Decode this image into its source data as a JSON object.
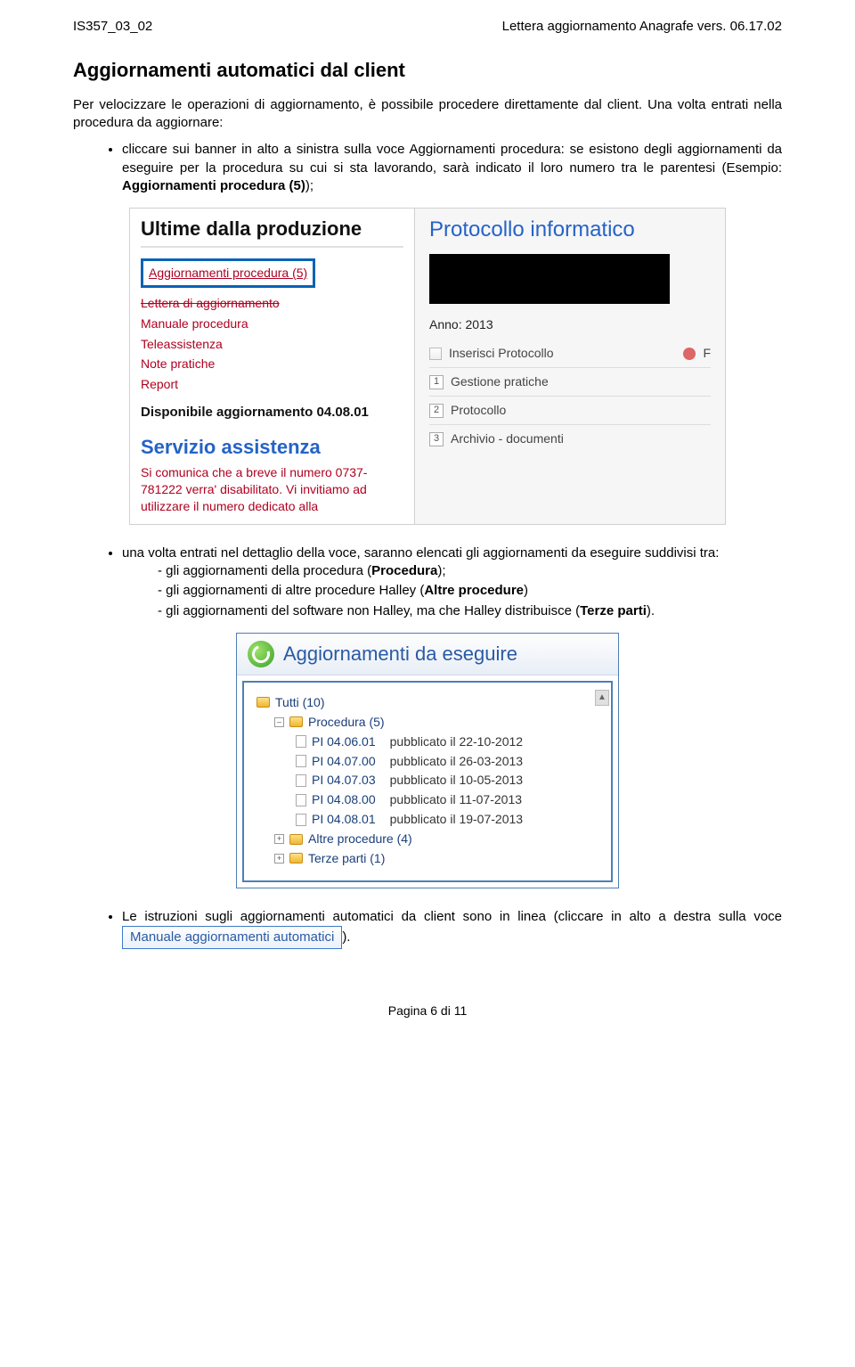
{
  "header": {
    "left": "IS357_03_02",
    "right": "Lettera aggiornamento Anagrafe vers. 06.17.02"
  },
  "title": "Aggiornamenti automatici dal client",
  "intro": "Per velocizzare le operazioni di aggiornamento, è possibile procedere direttamente dal client. Una volta entrati nella procedura da aggiornare:",
  "bullet1_a": "cliccare sui banner in alto a sinistra sulla voce ",
  "bullet1_b": "Aggiornamenti procedura",
  "bullet1_c": ": se esistono degli aggiornamenti da eseguire per la procedura su cui si sta lavorando, sarà indicato il loro numero tra le parentesi (Esempio: ",
  "bullet1_d": "Aggiornamenti procedura (5)",
  "bullet1_e": ");",
  "ss1": {
    "left_title": "Ultime dalla produzione",
    "link_highlight": "Aggiornamenti procedura (5)",
    "links": [
      "Lettera di aggiornamento",
      "Manuale procedura",
      "Teleassistenza",
      "Note pratiche",
      "Report"
    ],
    "dispo": "Disponibile aggiornamento 04.08.01",
    "serv_title": "Servizio assistenza",
    "serv_text": "Si comunica che a breve il numero 0737-781222 verra' disabilitato. Vi invitiamo ad utilizzare il numero dedicato alla",
    "right_title": "Protocollo informatico",
    "anno_label": "Anno:",
    "anno_value": "2013",
    "ins_proto": "Inserisci Protocollo",
    "ins_proto_end": "F",
    "menu": [
      {
        "n": "1",
        "label": "Gestione pratiche"
      },
      {
        "n": "2",
        "label": "Protocollo"
      },
      {
        "n": "3",
        "label": "Archivio - documenti"
      }
    ]
  },
  "bullet2": "una volta entrati nel dettaglio della voce, saranno elencati gli aggiornamenti da eseguire suddivisi tra:",
  "sub": {
    "a1": "gli aggiornamenti della procedura (",
    "a2": "Procedura",
    "a3": ");",
    "b1": "gli aggiornamenti di altre procedure Halley (",
    "b2": "Altre procedure",
    "b3": ")",
    "c1": "gli aggiornamenti del software non Halley, ma che Halley distribuisce (",
    "c2": "Terze parti",
    "c3": ")."
  },
  "ss2": {
    "title": "Aggiornamenti da eseguire",
    "root": "Tutti (10)",
    "proc": "Procedura (5)",
    "items": [
      {
        "v": "PI 04.06.01",
        "pub": "pubblicato il 22-10-2012"
      },
      {
        "v": "PI 04.07.00",
        "pub": "pubblicato il 26-03-2013"
      },
      {
        "v": "PI 04.07.03",
        "pub": "pubblicato il 10-05-2013"
      },
      {
        "v": "PI 04.08.00",
        "pub": "pubblicato il 11-07-2013"
      },
      {
        "v": "PI 04.08.01",
        "pub": "pubblicato il 19-07-2013"
      }
    ],
    "altre": "Altre procedure (4)",
    "terze": "Terze parti (1)"
  },
  "bullet3_a": "Le istruzioni sugli aggiornamenti automatici da client sono in linea (cliccare in alto a destra sulla voce ",
  "bullet3_link": "Manuale aggiornamenti automatici",
  "bullet3_b": ").",
  "footer": "Pagina 6 di 11"
}
